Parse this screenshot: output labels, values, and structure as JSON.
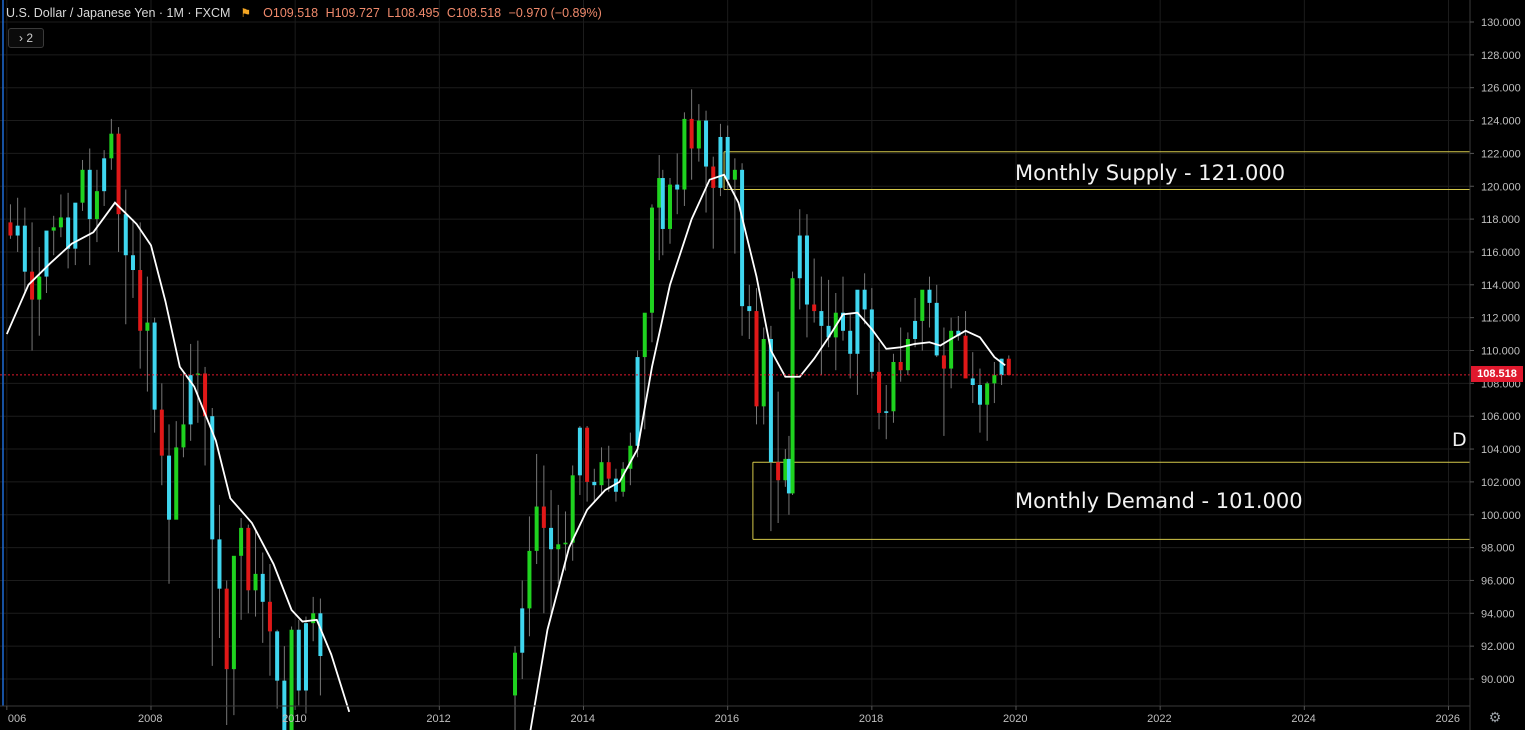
{
  "header": {
    "symbol": "U.S. Dollar / Japanese Yen · 1M · FXCM",
    "open_label": "O",
    "open": "109.518",
    "high_label": "H",
    "high": "109.727",
    "low_label": "L",
    "low": "108.495",
    "close_label": "C",
    "close": "108.518",
    "change": "−0.970 (−0.89%)"
  },
  "indicator_badge": "› 2",
  "current_price_label": "108.518",
  "colors": {
    "background": "#000000",
    "grid": "#1c1c1c",
    "axis_text": "#bfbfbf",
    "candle_up": "#1fd21f",
    "candle_down": "#e01818",
    "candle_cyan": "#3fd6ef",
    "ma_line": "#ffffff",
    "zone_line": "#d4c84a",
    "price_line": "#e0182d"
  },
  "chart_data": {
    "type": "candlestick",
    "instrument": "USDJPY",
    "timeframe": "1M",
    "ylim": [
      88.5,
      131.0
    ],
    "xlim": [
      2006.0,
      2026.6
    ],
    "y_ticks": [
      "130.000",
      "128.000",
      "126.000",
      "124.000",
      "122.000",
      "120.000",
      "118.000",
      "116.000",
      "114.000",
      "112.000",
      "110.000",
      "108.000",
      "106.000",
      "104.000",
      "102.000",
      "100.000",
      "98.000",
      "96.000",
      "94.000",
      "92.000",
      "90.000"
    ],
    "x_ticks": [
      "006",
      "2008",
      "2010",
      "2012",
      "2014",
      "2016",
      "2018",
      "2020",
      "2022",
      "2024",
      "2026"
    ],
    "current_price": 108.518,
    "zones": [
      {
        "label": "Monthly Supply - 121.000",
        "top": 122.1,
        "bottom": 119.8,
        "start": 2015.95
      },
      {
        "label": "Monthly Demand - 101.000",
        "top": 103.2,
        "bottom": 98.5,
        "start": 2016.35
      }
    ],
    "edge_label": "D",
    "moving_average": [
      [
        2006.0,
        111.0
      ],
      [
        2006.3,
        114.0
      ],
      [
        2006.6,
        115.3
      ],
      [
        2006.9,
        116.5
      ],
      [
        2007.2,
        117.2
      ],
      [
        2007.5,
        119.0
      ],
      [
        2007.8,
        117.7
      ],
      [
        2008.0,
        116.4
      ],
      [
        2008.2,
        113.0
      ],
      [
        2008.4,
        109.0
      ],
      [
        2008.6,
        107.8
      ],
      [
        2008.9,
        104.5
      ],
      [
        2009.1,
        101.0
      ],
      [
        2009.4,
        99.5
      ],
      [
        2009.7,
        97.0
      ],
      [
        2009.95,
        94.2
      ],
      [
        2010.1,
        93.5
      ],
      [
        2010.3,
        93.6
      ],
      [
        2010.5,
        91.5
      ],
      [
        2010.75,
        88.0
      ],
      [
        2013.25,
        86.5
      ],
      [
        2013.5,
        93.0
      ],
      [
        2013.8,
        98.0
      ],
      [
        2014.05,
        100.3
      ],
      [
        2014.3,
        101.5
      ],
      [
        2014.5,
        102.0
      ],
      [
        2014.75,
        104.0
      ],
      [
        2014.95,
        109.0
      ],
      [
        2015.2,
        114.0
      ],
      [
        2015.5,
        118.0
      ],
      [
        2015.75,
        120.4
      ],
      [
        2015.95,
        120.7
      ],
      [
        2016.15,
        119.0
      ],
      [
        2016.4,
        114.5
      ],
      [
        2016.6,
        110.0
      ],
      [
        2016.8,
        108.4
      ],
      [
        2017.0,
        108.4
      ],
      [
        2017.2,
        109.5
      ],
      [
        2017.4,
        110.8
      ],
      [
        2017.6,
        112.2
      ],
      [
        2017.8,
        112.3
      ],
      [
        2018.0,
        111.3
      ],
      [
        2018.2,
        110.1
      ],
      [
        2018.4,
        110.2
      ],
      [
        2018.6,
        110.4
      ],
      [
        2018.8,
        110.5
      ],
      [
        2018.95,
        110.3
      ],
      [
        2019.1,
        110.7
      ],
      [
        2019.3,
        111.2
      ],
      [
        2019.5,
        110.8
      ],
      [
        2019.7,
        109.6
      ],
      [
        2019.85,
        109.1
      ]
    ],
    "candles": [
      [
        2006.05,
        117.8,
        118.9,
        116.8,
        117.0
      ],
      [
        2006.15,
        117.0,
        119.3,
        116.0,
        117.6
      ],
      [
        2006.25,
        117.6,
        118.7,
        113.5,
        114.8
      ],
      [
        2006.35,
        114.8,
        117.8,
        110.0,
        113.1
      ],
      [
        2006.45,
        113.1,
        116.3,
        110.9,
        114.5
      ],
      [
        2006.55,
        114.5,
        117.1,
        113.5,
        117.3
      ],
      [
        2006.65,
        117.3,
        118.2,
        115.8,
        117.5
      ],
      [
        2006.75,
        117.5,
        119.5,
        116.9,
        118.1
      ],
      [
        2006.85,
        118.1,
        119.6,
        115.0,
        116.2
      ],
      [
        2006.95,
        116.2,
        118.9,
        115.2,
        119.0
      ],
      [
        2007.05,
        119.0,
        121.6,
        118.5,
        121.0
      ],
      [
        2007.15,
        121.0,
        122.3,
        115.2,
        118.0
      ],
      [
        2007.25,
        118.0,
        121.0,
        116.6,
        119.7
      ],
      [
        2007.35,
        119.7,
        122.2,
        118.8,
        121.7
      ],
      [
        2007.45,
        121.7,
        124.1,
        121.0,
        123.2
      ],
      [
        2007.55,
        123.2,
        123.6,
        116.0,
        118.3
      ],
      [
        2007.65,
        118.3,
        119.8,
        111.6,
        115.8
      ],
      [
        2007.75,
        115.8,
        118.0,
        113.2,
        114.9
      ],
      [
        2007.85,
        114.9,
        117.8,
        108.9,
        111.2
      ],
      [
        2007.95,
        111.2,
        114.5,
        107.5,
        111.7
      ],
      [
        2008.05,
        111.7,
        112.0,
        105.0,
        106.4
      ],
      [
        2008.15,
        106.4,
        108.0,
        101.8,
        103.6
      ],
      [
        2008.25,
        103.6,
        105.5,
        95.8,
        99.7
      ],
      [
        2008.35,
        99.7,
        105.7,
        101.0,
        104.1
      ],
      [
        2008.45,
        104.1,
        108.6,
        103.5,
        105.5
      ],
      [
        2008.55,
        105.5,
        110.4,
        104.5,
        108.5
      ],
      [
        2008.65,
        108.5,
        110.6,
        105.6,
        108.6
      ],
      [
        2008.75,
        108.6,
        109.0,
        103.0,
        106.0
      ],
      [
        2008.85,
        106.0,
        106.5,
        90.8,
        98.5
      ],
      [
        2008.95,
        98.5,
        100.6,
        92.5,
        95.5
      ],
      [
        2009.05,
        95.5,
        96.0,
        87.2,
        90.6
      ],
      [
        2009.15,
        90.6,
        95.5,
        87.8,
        97.5
      ],
      [
        2009.25,
        97.5,
        99.8,
        93.6,
        99.2
      ],
      [
        2009.35,
        99.2,
        99.4,
        94.0,
        95.4
      ],
      [
        2009.45,
        95.4,
        99.0,
        93.8,
        96.4
      ],
      [
        2009.55,
        96.4,
        97.7,
        92.2,
        94.7
      ],
      [
        2009.65,
        94.7,
        97.0,
        90.2,
        92.9
      ],
      [
        2009.75,
        92.9,
        93.0,
        88.2,
        89.9
      ],
      [
        2009.85,
        89.9,
        92.0,
        86.3,
        86.6
      ],
      [
        2009.95,
        86.6,
        93.2,
        84.8,
        93.0
      ],
      [
        2010.05,
        93.0,
        93.6,
        88.4,
        89.3
      ],
      [
        2010.15,
        89.3,
        93.8,
        87.9,
        93.4
      ],
      [
        2010.25,
        93.4,
        95.0,
        92.3,
        94.0
      ],
      [
        2010.35,
        94.0,
        94.9,
        89.0,
        91.4
      ]
    ],
    "candles2": [
      [
        2013.05,
        89.0,
        92.0,
        86.0,
        91.6
      ],
      [
        2013.15,
        91.6,
        96.0,
        90.0,
        94.3
      ],
      [
        2013.25,
        94.3,
        99.9,
        92.6,
        97.8
      ],
      [
        2013.35,
        97.8,
        103.7,
        97.0,
        100.5
      ],
      [
        2013.45,
        100.5,
        103.0,
        94.0,
        99.2
      ],
      [
        2013.55,
        99.2,
        101.5,
        93.8,
        97.9
      ],
      [
        2013.65,
        97.9,
        100.6,
        95.8,
        98.2
      ],
      [
        2013.75,
        98.2,
        100.2,
        96.6,
        98.3
      ],
      [
        2013.85,
        98.3,
        103.0,
        97.2,
        102.4
      ],
      [
        2013.95,
        102.4,
        105.4,
        101.2,
        105.3
      ],
      [
        2014.05,
        105.3,
        105.4,
        100.8,
        102.0
      ],
      [
        2014.15,
        102.0,
        102.8,
        100.8,
        101.8
      ],
      [
        2014.25,
        101.8,
        104.1,
        101.2,
        103.2
      ],
      [
        2014.35,
        103.2,
        104.2,
        101.4,
        102.2
      ],
      [
        2014.45,
        102.2,
        102.8,
        100.8,
        101.4
      ],
      [
        2014.55,
        101.4,
        103.2,
        101.1,
        102.8
      ],
      [
        2014.65,
        102.8,
        105.0,
        101.8,
        104.2
      ],
      [
        2014.75,
        104.2,
        110.0,
        103.5,
        109.6
      ],
      [
        2014.85,
        109.6,
        112.0,
        105.2,
        112.3
      ],
      [
        2014.95,
        112.3,
        118.9,
        110.5,
        118.7
      ],
      [
        2015.05,
        118.7,
        121.9,
        115.5,
        120.5
      ],
      [
        2015.1,
        120.5,
        121.0,
        115.8,
        117.4
      ],
      [
        2015.2,
        117.4,
        120.5,
        116.5,
        120.1
      ],
      [
        2015.3,
        120.1,
        122.0,
        118.3,
        119.8
      ],
      [
        2015.4,
        119.8,
        124.5,
        118.8,
        124.1
      ],
      [
        2015.5,
        124.1,
        125.9,
        120.4,
        122.3
      ],
      [
        2015.6,
        122.3,
        125.0,
        121.5,
        124.0
      ],
      [
        2015.7,
        124.0,
        124.6,
        118.4,
        121.2
      ],
      [
        2015.8,
        121.2,
        121.8,
        116.2,
        119.9
      ],
      [
        2015.9,
        119.9,
        123.8,
        119.4,
        123.0
      ],
      [
        2016.0,
        123.0,
        123.7,
        119.8,
        120.4
      ],
      [
        2016.1,
        120.4,
        121.7,
        115.9,
        121.0
      ],
      [
        2016.2,
        121.0,
        121.4,
        110.9,
        112.7
      ],
      [
        2016.3,
        112.7,
        114.0,
        110.7,
        112.4
      ],
      [
        2016.4,
        112.4,
        113.8,
        105.5,
        106.6
      ],
      [
        2016.5,
        106.6,
        111.4,
        105.5,
        110.7
      ],
      [
        2016.6,
        110.7,
        111.5,
        99.0,
        103.2
      ],
      [
        2016.7,
        103.2,
        107.5,
        99.5,
        102.1
      ],
      [
        2016.8,
        102.1,
        104.0,
        101.7,
        103.4
      ],
      [
        2016.85,
        103.4,
        104.8,
        100.0,
        101.3
      ],
      [
        2016.9,
        101.3,
        114.8,
        101.2,
        114.4
      ],
      [
        2017.0,
        114.4,
        118.6,
        112.5,
        117.0
      ],
      [
        2017.1,
        117.0,
        118.3,
        110.8,
        112.8
      ],
      [
        2017.2,
        112.8,
        115.6,
        111.7,
        112.4
      ],
      [
        2017.3,
        112.4,
        114.5,
        108.5,
        111.5
      ],
      [
        2017.4,
        111.5,
        114.3,
        110.2,
        110.8
      ],
      [
        2017.5,
        110.8,
        113.5,
        108.8,
        112.3
      ],
      [
        2017.6,
        112.3,
        114.5,
        110.6,
        111.2
      ],
      [
        2017.7,
        111.2,
        112.2,
        108.3,
        109.8
      ],
      [
        2017.8,
        109.8,
        113.4,
        107.3,
        113.7
      ],
      [
        2017.9,
        113.7,
        114.7,
        111.6,
        112.5
      ],
      [
        2018.0,
        112.5,
        113.8,
        108.3,
        108.7
      ],
      [
        2018.1,
        108.7,
        110.5,
        105.2,
        106.2
      ],
      [
        2018.2,
        106.2,
        107.9,
        104.6,
        106.3
      ],
      [
        2018.3,
        106.3,
        109.8,
        105.6,
        109.3
      ],
      [
        2018.4,
        109.3,
        111.4,
        108.1,
        108.8
      ],
      [
        2018.5,
        108.8,
        111.1,
        108.5,
        110.7
      ],
      [
        2018.6,
        110.7,
        113.2,
        110.2,
        111.8
      ],
      [
        2018.7,
        111.8,
        113.2,
        110.0,
        113.7
      ],
      [
        2018.8,
        113.7,
        114.5,
        111.4,
        112.9
      ],
      [
        2018.9,
        112.9,
        114.0,
        109.6,
        109.7
      ],
      [
        2019.0,
        109.7,
        111.4,
        104.8,
        108.9
      ],
      [
        2019.1,
        108.9,
        112.0,
        107.7,
        111.2
      ],
      [
        2019.2,
        111.2,
        112.1,
        110.6,
        110.9
      ],
      [
        2019.3,
        110.9,
        112.4,
        109.0,
        108.3
      ],
      [
        2019.4,
        108.3,
        109.9,
        106.8,
        107.9
      ],
      [
        2019.5,
        107.9,
        108.9,
        105.0,
        106.7
      ],
      [
        2019.6,
        106.7,
        108.1,
        104.5,
        108.0
      ],
      [
        2019.7,
        108.0,
        109.3,
        106.8,
        108.5
      ],
      [
        2019.8,
        108.5,
        109.5,
        107.9,
        109.5
      ],
      [
        2019.9,
        109.5,
        109.7,
        108.5,
        108.5
      ]
    ],
    "annotations": [
      "Monthly Supply - 121.000",
      "Monthly Demand - 101.000",
      "D"
    ]
  }
}
